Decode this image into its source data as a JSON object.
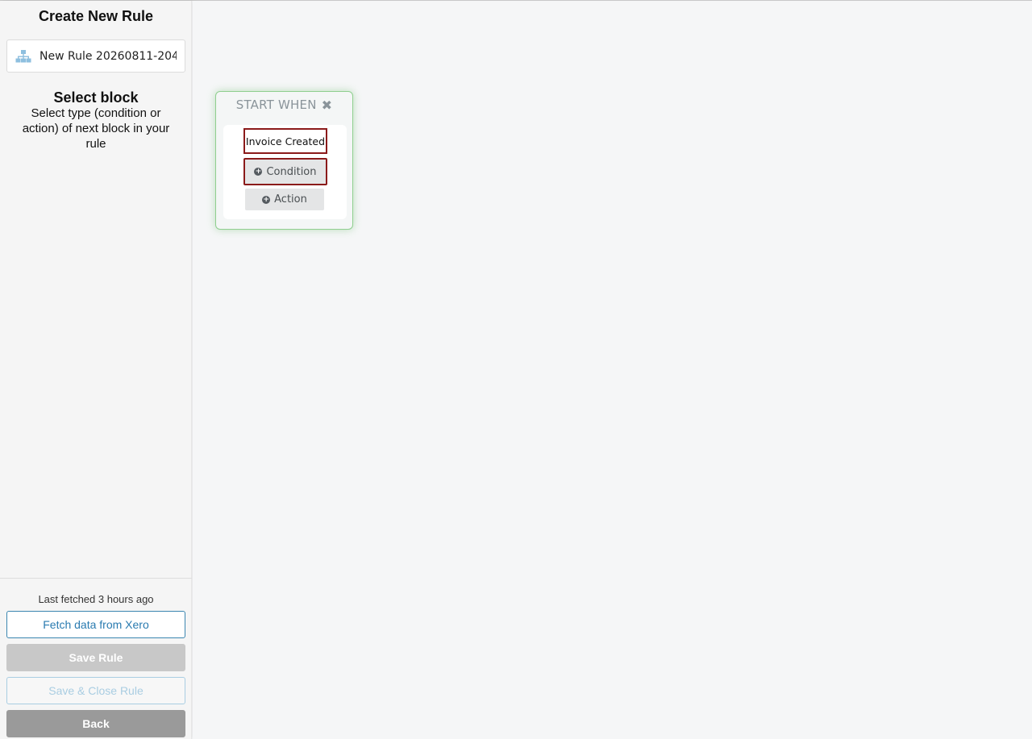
{
  "sidebar": {
    "title": "Create New Rule",
    "rule_name_value": "New Rule 20260811-204",
    "select_block_title": "Select block",
    "select_block_description": "Select type (condition or action) of next block in your rule",
    "footer": {
      "last_fetched": "Last fetched 3 hours ago",
      "fetch_label": "Fetch data from Xero",
      "save_label": "Save Rule",
      "save_close_label": "Save & Close Rule",
      "back_label": "Back"
    }
  },
  "canvas": {
    "start_block": {
      "header": "START WHEN",
      "close_icon": "✖",
      "trigger": "Invoice Created",
      "condition_label": "Condition",
      "action_label": "Action",
      "plus_icon": "+"
    }
  },
  "colors": {
    "accent_blue": "#2a7bb0",
    "start_border_green": "#8fcf8f",
    "highlight_red": "#8b1a1a"
  }
}
